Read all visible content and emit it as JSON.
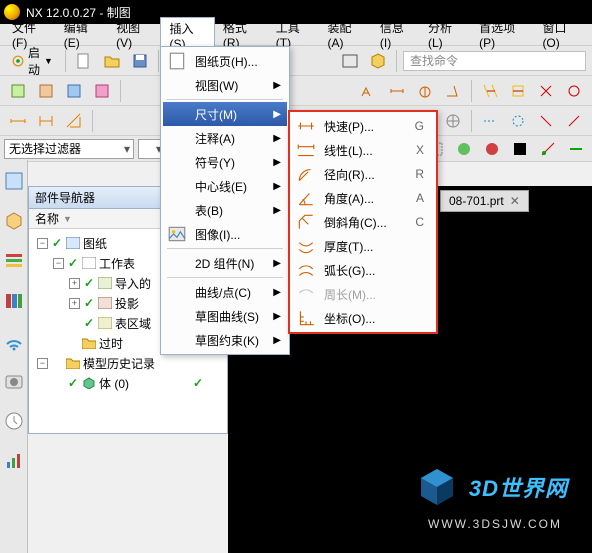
{
  "title": "NX 12.0.0.27 - 制图",
  "menubar": [
    "文件(F)",
    "编辑(E)",
    "视图(V)",
    "插入(S)",
    "格式(R)",
    "工具(T)",
    "装配(A)",
    "信息(I)",
    "分析(L)",
    "首选项(P)",
    "窗口(O)"
  ],
  "menubar_open_index": 3,
  "start_label": "启动",
  "search_placeholder": "查找命令",
  "filter_label": "无选择过滤器",
  "nav": {
    "title": "部件导航器",
    "col": "名称",
    "nodes": {
      "root": "图纸",
      "wsheet": "工作表",
      "import": "导入的",
      "proj": "投影",
      "region": "表区域",
      "obsolete": "过时",
      "history": "模型历史记录",
      "body": "体 (0)"
    }
  },
  "insert_menu": [
    {
      "label": "图纸页(H)...",
      "icon": "sheet"
    },
    {
      "label": "视图(W)",
      "sub": true
    },
    {
      "sep": true
    },
    {
      "label": "尺寸(M)",
      "sub": true,
      "sel": true
    },
    {
      "label": "注释(A)",
      "sub": true
    },
    {
      "label": "符号(Y)",
      "sub": true
    },
    {
      "label": "中心线(E)",
      "sub": true
    },
    {
      "label": "表(B)",
      "sub": true
    },
    {
      "label": "图像(I)...",
      "icon": "image"
    },
    {
      "sep": true
    },
    {
      "label": "2D 组件(N)",
      "sub": true
    },
    {
      "sep": true
    },
    {
      "label": "曲线/点(C)",
      "sub": true
    },
    {
      "label": "草图曲线(S)",
      "sub": true
    },
    {
      "label": "草图约束(K)",
      "sub": true
    }
  ],
  "dim_menu": [
    {
      "label": "快速(P)...",
      "sc": "G",
      "icon": "rapid"
    },
    {
      "label": "线性(L)...",
      "sc": "X",
      "icon": "linear"
    },
    {
      "label": "径向(R)...",
      "sc": "R",
      "icon": "radial"
    },
    {
      "label": "角度(A)...",
      "sc": "A",
      "icon": "angular"
    },
    {
      "label": "倒斜角(C)...",
      "sc": "C",
      "icon": "chamfer"
    },
    {
      "label": "厚度(T)...",
      "icon": "thick"
    },
    {
      "label": "弧长(G)...",
      "icon": "arc"
    },
    {
      "label": "周长(M)...",
      "icon": "perim",
      "dim": true
    },
    {
      "label": "坐标(O)...",
      "icon": "ord"
    }
  ],
  "tab_label": "08-701.prt",
  "watermark": {
    "brand": "3D世界网",
    "url": "WWW.3DSJW.COM"
  }
}
